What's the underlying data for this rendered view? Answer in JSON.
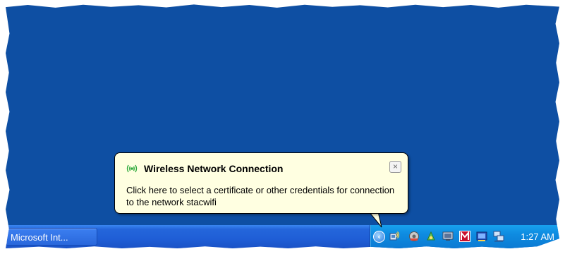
{
  "taskbar": {
    "task_button_label": "Microsoft Int..."
  },
  "tray": {
    "clock": "1:27 AM",
    "icons": [
      "show-hidden-icons-chevron",
      "wireless-network-icon",
      "audio-icon",
      "network-tool-icon",
      "monitor-icon",
      "mcafee-icon",
      "security-icon",
      "network-connections-icon"
    ]
  },
  "balloon": {
    "title": "Wireless Network Connection",
    "message": "Click here to select a certificate or other credentials for connection to the network stacwifi",
    "close_label": "×",
    "icon": "wireless-signal-icon"
  },
  "colors": {
    "desktop": "#0e4fa3",
    "taskbar": "#1f5ed6",
    "tray": "#0e8be0",
    "balloon": "#ffffe1"
  }
}
